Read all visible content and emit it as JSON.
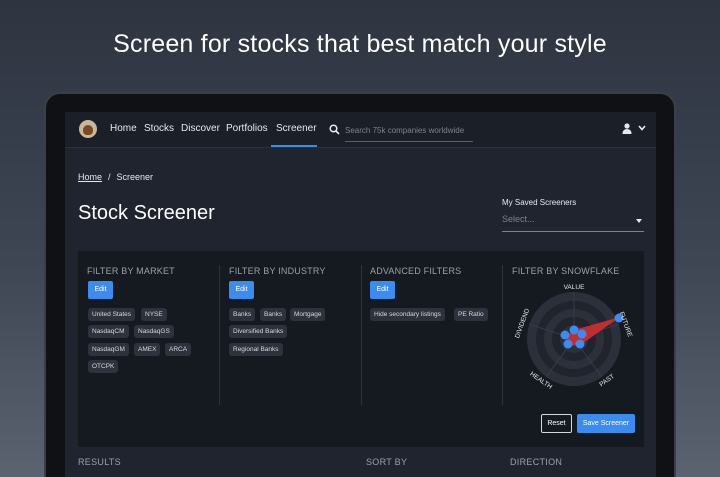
{
  "headline": "Screen for stocks that best match your style",
  "nav": {
    "items": [
      "Home",
      "Stocks",
      "Discover",
      "Portfolios",
      "Screener"
    ],
    "active": "Screener",
    "search_placeholder": "Search 75k companies worldwide",
    "icons": [
      "logo",
      "search-icon",
      "user-icon",
      "chevron-down-icon"
    ]
  },
  "breadcrumb": {
    "home": "Home",
    "separator": "/",
    "current": "Screener"
  },
  "page_title": "Stock Screener",
  "saved_screeners": {
    "label": "My Saved Screeners",
    "placeholder": "Select..."
  },
  "filters": {
    "market": {
      "title": "FILTER BY MARKET",
      "edit": "Edit",
      "chips": [
        "United States",
        "NYSE",
        "NasdaqCM",
        "NasdaqGS",
        "NasdaqGM",
        "AMEX",
        "ARCA",
        "OTCPK"
      ]
    },
    "industry": {
      "title": "FILTER BY INDUSTRY",
      "edit": "Edit",
      "chips": [
        "Banks",
        "Banks",
        "Mortgage",
        "Diversified Banks",
        "Regional Banks"
      ]
    },
    "advanced": {
      "title": "ADVANCED FILTERS",
      "edit": "Edit",
      "chips": [
        "Hide secondary listings",
        "PE Ratio"
      ]
    },
    "snowflake": {
      "title": "FILTER BY SNOWFLAKE",
      "axes": [
        "VALUE",
        "FUTURE",
        "PAST",
        "HEALTH",
        "DIVIDEND"
      ]
    }
  },
  "actions": {
    "reset": "Reset",
    "save": "Save Screener"
  },
  "results_header": {
    "results": "RESULTS",
    "sort_by": "SORT BY",
    "direction": "DIRECTION"
  },
  "colors": {
    "accent": "#3c8cf0",
    "snowflake_fill": "#d32f2f",
    "panel": "#151920",
    "screen": "#20242e"
  }
}
